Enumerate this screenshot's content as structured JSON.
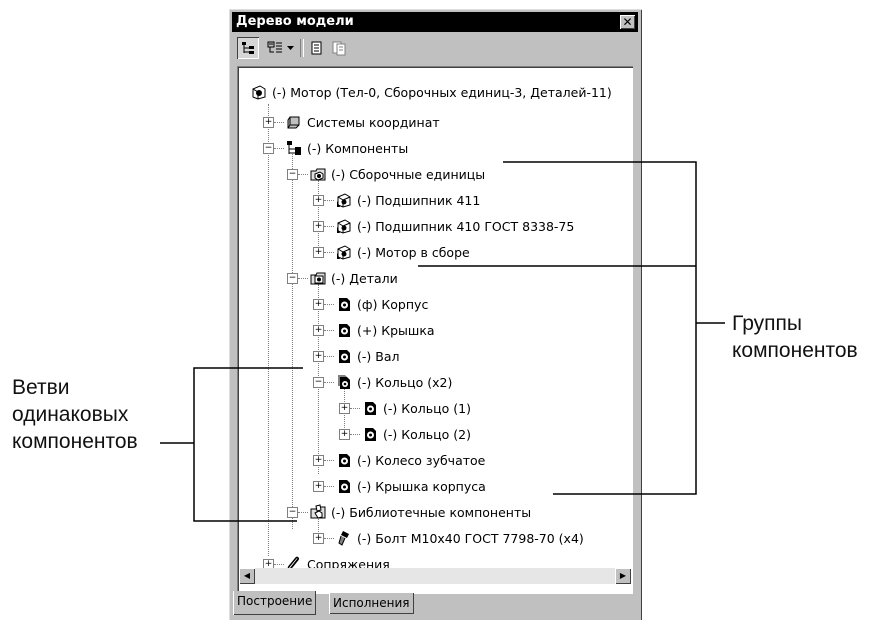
{
  "window": {
    "title": "Дерево модели",
    "close_label": "✕"
  },
  "toolbar": {
    "buttons": [
      "tree-view-icon",
      "structure-list-icon",
      "dropdown-arrow-icon",
      "page-icon",
      "page-copy-icon"
    ]
  },
  "tree": {
    "root": "(-) Мотор (Тел-0, Сборочных единиц-3, Деталей-11)",
    "coord_systems": "Системы координат",
    "components": "(-) Компоненты",
    "assemblies": "(-) Сборочные единицы",
    "bearing_411": "(-) Подшипник 411",
    "bearing_410": "(-) Подшипник 410 ГОСТ 8338-75",
    "motor_assembly": "(-) Мотор в сборе",
    "parts": "(-) Детали",
    "housing": "(ф) Корпус",
    "cover": "(+) Крышка",
    "shaft": "(-) Вал",
    "ring_group": "(-) Кольцо (x2)",
    "ring_1": "(-) Кольцо (1)",
    "ring_2": "(-) Кольцо (2)",
    "gear": "(-) Колесо зубчатое",
    "housing_cover": "(-) Крышка корпуса",
    "library": "(-) Библиотечные компоненты",
    "bolt": "(-) Болт М10х40 ГОСТ 7798-70 (x4)",
    "mates": "Сопряжения"
  },
  "tabs": {
    "build": "Построение",
    "variants": "Исполнения"
  },
  "annotations": {
    "groups_line1": "Группы",
    "groups_line2": "компонентов",
    "branches_line1": "Ветви",
    "branches_line2": "одинаковых",
    "branches_line3": "компонентов"
  },
  "colors": {
    "titlebar": "#000000",
    "window_face": "#c0c0c0",
    "tree_background": "#ffffff"
  }
}
